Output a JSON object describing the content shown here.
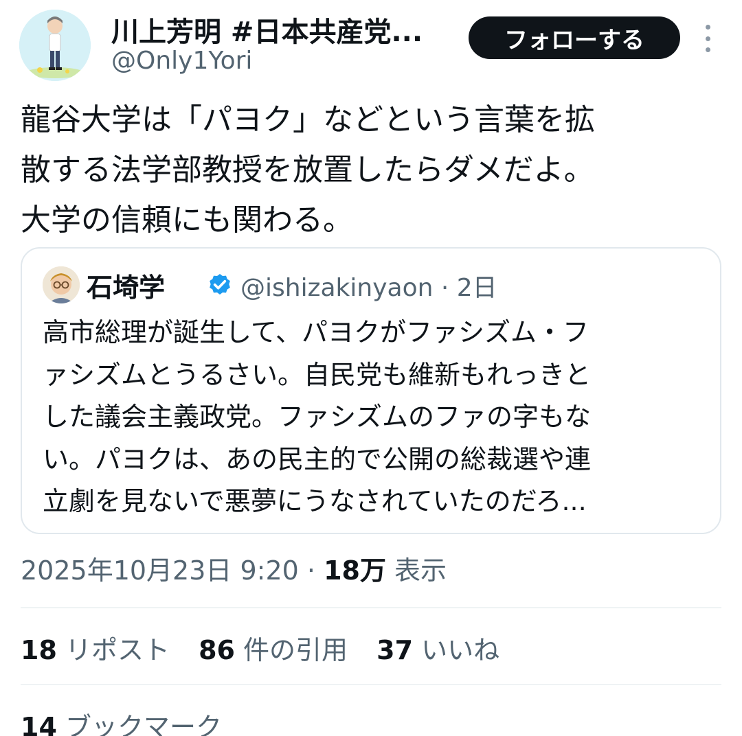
{
  "author": {
    "display_name": "川上芳明 #日本共産党...",
    "handle": "@Only1Yori"
  },
  "follow_label": "フォローする",
  "tweet": {
    "lines": [
      "龍谷大学は「パヨク」などという言葉を拡",
      "散する法学部教授を放置したらダメだよ。",
      "大学の信頼にも関わる。"
    ]
  },
  "quote": {
    "name": "石埼学",
    "handle": "@ishizakinyaon",
    "separator": " · ",
    "time": "2日",
    "verified": true,
    "lines": [
      "高市総理が誕生して、パヨクがファシズム・フ",
      "ァシズムとうるさい。自民党も維新もれっきと",
      "した議会主義政党。ファシズムのファの字もな",
      "い。パヨクは、あの民主的で公開の総裁選や連",
      "立劇を見ないで悪夢にうなされていたのだろ..."
    ]
  },
  "meta": {
    "timestamp": "2025年10月23日 9:20",
    "separator": " · ",
    "views_count": "18万",
    "views_label": " 表示"
  },
  "stats": {
    "reposts_count": "18",
    "reposts_label": " リポスト",
    "quotes_count": "86",
    "quotes_label": " 件の引用",
    "likes_count": "37",
    "likes_label": " いいね",
    "bookmarks_count": "14",
    "bookmarks_label": " ブックマーク"
  },
  "colors": {
    "text_primary": "#0f1419",
    "text_secondary": "#536471",
    "verified_blue": "#1d9bf0",
    "border": "#e1e8ed",
    "button_bg": "#0f1419"
  },
  "icons": {
    "more": "more-vertical-icon",
    "verified": "verified-badge-icon"
  }
}
